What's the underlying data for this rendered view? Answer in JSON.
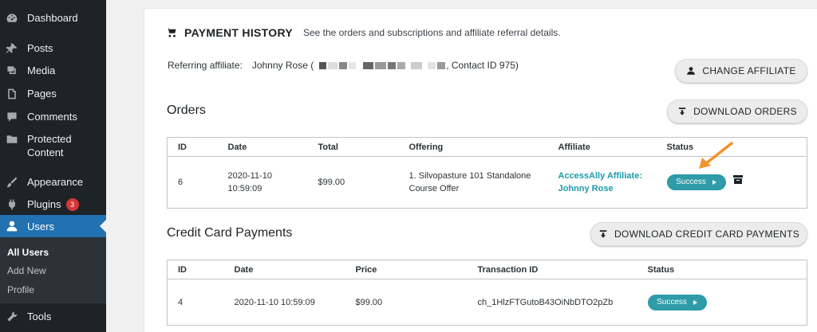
{
  "sidebar": {
    "items": [
      {
        "key": "dashboard",
        "label": "Dashboard",
        "icon": "dashboard-icon"
      },
      {
        "key": "posts",
        "label": "Posts",
        "icon": "pin-icon"
      },
      {
        "key": "media",
        "label": "Media",
        "icon": "media-icon"
      },
      {
        "key": "pages",
        "label": "Pages",
        "icon": "page-icon"
      },
      {
        "key": "comments",
        "label": "Comments",
        "icon": "comment-icon"
      },
      {
        "key": "protected",
        "label": "Protected Content",
        "icon": "folder-icon"
      },
      {
        "key": "appearance",
        "label": "Appearance",
        "icon": "brush-icon"
      },
      {
        "key": "plugins",
        "label": "Plugins",
        "icon": "plug-icon",
        "badge": "3"
      },
      {
        "key": "users",
        "label": "Users",
        "icon": "user-icon"
      },
      {
        "key": "tools",
        "label": "Tools",
        "icon": "wrench-icon"
      }
    ],
    "submenu": [
      "All Users",
      "Add New",
      "Profile"
    ]
  },
  "payment_history": {
    "title": "PAYMENT HISTORY",
    "subtitle": "See the orders and subscriptions and affiliate referral details.",
    "referring_label": "Referring affiliate:",
    "referring_name": "Johnny Rose (",
    "referring_tail": ", Contact ID 975)",
    "change_affiliate_label": "CHANGE AFFILIATE"
  },
  "orders": {
    "title": "Orders",
    "download_label": "DOWNLOAD ORDERS",
    "columns": [
      "ID",
      "Date",
      "Total",
      "Offering",
      "Affiliate",
      "Status"
    ],
    "row": {
      "id": "6",
      "date_line1": "2020-11-10",
      "date_line2": "10:59:09",
      "total": "$99.00",
      "offering_line1": "1. Silvopasture 101 Standalone",
      "offering_line2": "Course Offer",
      "affiliate_line1": "AccessAlly Affiliate:",
      "affiliate_line2": "Johnny Rose",
      "status": "Success"
    }
  },
  "credit_card": {
    "title": "Credit Card Payments",
    "download_label": "DOWNLOAD CREDIT CARD PAYMENTS",
    "columns": [
      "ID",
      "Date",
      "Price",
      "Transaction ID",
      "Status"
    ],
    "row": {
      "id": "4",
      "date": "2020-11-10 10:59:09",
      "price": "$99.00",
      "transaction_id": "ch_1HlzFTGutoB43OiNbDTO2pZb",
      "status": "Success"
    }
  },
  "colors": {
    "sidebar_bg": "#1d2327",
    "active_menu": "#2271b1",
    "status_pill": "#2e9ba8",
    "affiliate_link": "#1e9aa8",
    "annotation_arrow": "#f0932b"
  }
}
